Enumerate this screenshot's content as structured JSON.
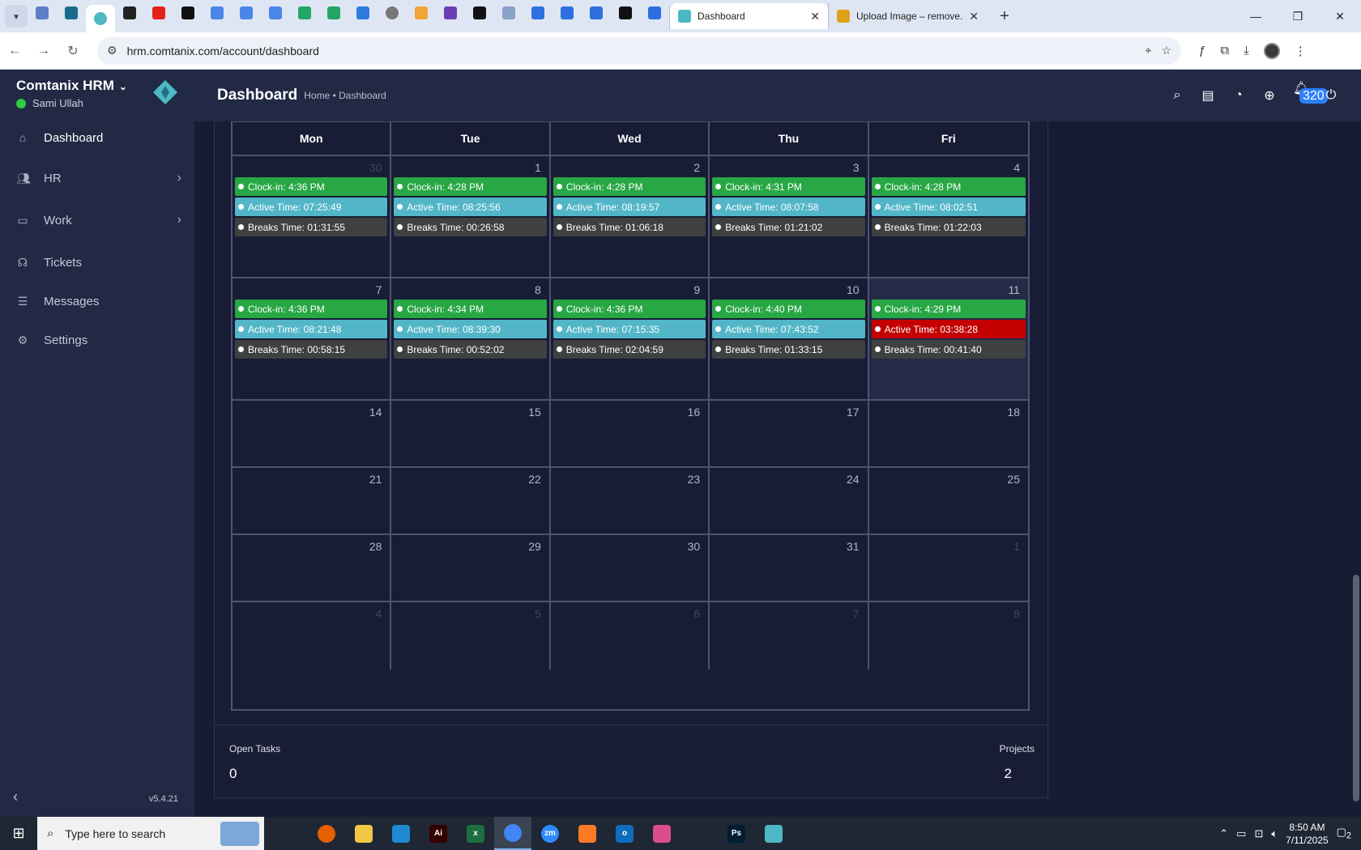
{
  "browser": {
    "tabs": [
      {
        "icon": "chart-favicon-icon",
        "color": "#5b7ec9"
      },
      {
        "icon": "shield-favicon-icon",
        "color": "#1a6b8a"
      },
      {
        "icon": "comtanix-favicon-icon",
        "color": "#4db8c4",
        "active": true
      },
      {
        "icon": "chatgpt-favicon-icon",
        "color": "#222222"
      },
      {
        "icon": "youtube-favicon-icon",
        "color": "#e62117"
      },
      {
        "icon": "bolt-favicon-icon",
        "color": "#111111"
      },
      {
        "icon": "docs-favicon-icon",
        "color": "#4a86e8"
      },
      {
        "icon": "docs-favicon-icon",
        "color": "#4a86e8"
      },
      {
        "icon": "docs-favicon-icon",
        "color": "#4a86e8"
      },
      {
        "icon": "sheets-favicon-icon",
        "color": "#23a566"
      },
      {
        "icon": "sheets-favicon-icon",
        "color": "#23a566"
      },
      {
        "icon": "app-favicon-icon",
        "color": "#2d7be0"
      },
      {
        "icon": "globe-favicon-icon",
        "color": "#777777"
      },
      {
        "icon": "heart-favicon-icon",
        "color": "#f2a33a"
      },
      {
        "icon": "code-favicon-icon",
        "color": "#6a3fb5"
      },
      {
        "icon": "a-favicon-icon",
        "color": "#111111"
      },
      {
        "icon": "grid-favicon-icon",
        "color": "#8aa1c8"
      },
      {
        "icon": "forms-favicon-icon",
        "color": "#2d6fe0"
      },
      {
        "icon": "forms-favicon-icon",
        "color": "#2d6fe0"
      },
      {
        "icon": "forms-favicon-icon",
        "color": "#2d6fe0"
      },
      {
        "icon": "m-favicon-icon",
        "color": "#111111"
      },
      {
        "icon": "forms-favicon-icon",
        "color": "#2d6fe0"
      }
    ],
    "tab_dashboard": "Dashboard",
    "tab_upload": "Upload Image – remove.",
    "url": "hrm.comtanix.com/account/dashboard"
  },
  "sidebar": {
    "brand": "Comtanix HRM",
    "user": "Sami Ullah",
    "items": [
      {
        "label": "Dashboard",
        "icon": "home-icon",
        "has_arrow": false,
        "active": true
      },
      {
        "label": "HR",
        "icon": "users-icon",
        "has_arrow": true
      },
      {
        "label": "Work",
        "icon": "briefcase-icon",
        "has_arrow": true
      },
      {
        "label": "Tickets",
        "icon": "headset-icon",
        "has_arrow": false
      },
      {
        "label": "Messages",
        "icon": "chat-icon",
        "has_arrow": false
      },
      {
        "label": "Settings",
        "icon": "gear-icon",
        "has_arrow": false
      }
    ],
    "version": "v5.4.21"
  },
  "header": {
    "title": "Dashboard",
    "breadcrumb": "Home • Dashboard",
    "notifications": "320"
  },
  "calendar": {
    "weekdays": [
      "Mon",
      "Tue",
      "Wed",
      "Thu",
      "Fri"
    ],
    "weeks": [
      [
        {
          "day": "30",
          "faded": true,
          "events": [
            [
              "green",
              "Clock-in: 4:36 PM"
            ],
            [
              "teal",
              "Active Time: 07:25:49"
            ],
            [
              "dark",
              "Breaks Time: 01:31:55"
            ]
          ]
        },
        {
          "day": "1",
          "events": [
            [
              "green",
              "Clock-in: 4:28 PM"
            ],
            [
              "teal",
              "Active Time: 08:25:56"
            ],
            [
              "dark",
              "Breaks Time: 00:26:58"
            ]
          ]
        },
        {
          "day": "2",
          "events": [
            [
              "green",
              "Clock-in: 4:28 PM"
            ],
            [
              "teal",
              "Active Time: 08:19:57"
            ],
            [
              "dark",
              "Breaks Time: 01:06:18"
            ]
          ]
        },
        {
          "day": "3",
          "events": [
            [
              "green",
              "Clock-in: 4:31 PM"
            ],
            [
              "teal",
              "Active Time: 08:07:58"
            ],
            [
              "dark",
              "Breaks Time: 01:21:02"
            ]
          ]
        },
        {
          "day": "4",
          "events": [
            [
              "green",
              "Clock-in: 4:28 PM"
            ],
            [
              "teal",
              "Active Time: 08:02:51"
            ],
            [
              "dark",
              "Breaks Time: 01:22:03"
            ]
          ]
        }
      ],
      [
        {
          "day": "7",
          "events": [
            [
              "green",
              "Clock-in: 4:36 PM"
            ],
            [
              "teal",
              "Active Time: 08:21:48"
            ],
            [
              "dark",
              "Breaks Time: 00:58:15"
            ]
          ]
        },
        {
          "day": "8",
          "events": [
            [
              "green",
              "Clock-in: 4:34 PM"
            ],
            [
              "teal",
              "Active Time: 08:39:30"
            ],
            [
              "dark",
              "Breaks Time: 00:52:02"
            ]
          ]
        },
        {
          "day": "9",
          "events": [
            [
              "green",
              "Clock-in: 4:36 PM"
            ],
            [
              "teal",
              "Active Time: 07:15:35"
            ],
            [
              "dark",
              "Breaks Time: 02:04:59"
            ]
          ]
        },
        {
          "day": "10",
          "events": [
            [
              "green",
              "Clock-in: 4:40 PM"
            ],
            [
              "teal",
              "Active Time: 07:43:52"
            ],
            [
              "dark",
              "Breaks Time: 01:33:15"
            ]
          ]
        },
        {
          "day": "11",
          "today": true,
          "events": [
            [
              "green",
              "Clock-in: 4:29 PM"
            ],
            [
              "red",
              "Active Time: 03:38:28"
            ],
            [
              "dark",
              "Breaks Time: 00:41:40"
            ]
          ]
        }
      ],
      [
        {
          "day": "14",
          "events": []
        },
        {
          "day": "15",
          "events": []
        },
        {
          "day": "16",
          "events": []
        },
        {
          "day": "17",
          "events": []
        },
        {
          "day": "18",
          "events": []
        }
      ],
      [
        {
          "day": "21",
          "events": []
        },
        {
          "day": "22",
          "events": []
        },
        {
          "day": "23",
          "events": []
        },
        {
          "day": "24",
          "events": []
        },
        {
          "day": "25",
          "events": []
        }
      ],
      [
        {
          "day": "28",
          "events": []
        },
        {
          "day": "29",
          "events": []
        },
        {
          "day": "30",
          "events": []
        },
        {
          "day": "31",
          "events": []
        },
        {
          "day": "1",
          "faded": true,
          "events": []
        }
      ],
      [
        {
          "day": "4",
          "faded": true,
          "events": []
        },
        {
          "day": "5",
          "faded": true,
          "events": []
        },
        {
          "day": "6",
          "faded": true,
          "events": []
        },
        {
          "day": "7",
          "faded": true,
          "events": []
        },
        {
          "day": "8",
          "faded": true,
          "events": []
        }
      ]
    ]
  },
  "stats": {
    "open_tasks_label": "Open Tasks",
    "open_tasks_value": "0",
    "projects_label": "Projects",
    "projects_value": "2"
  },
  "taskbar": {
    "search_placeholder": "Type here to search",
    "apps": [
      {
        "icon": "task-view-icon",
        "color": "#1f2734",
        "text": ""
      },
      {
        "icon": "firefox-icon",
        "color": "#e66000",
        "text": ""
      },
      {
        "icon": "folder-icon",
        "color": "#f2c744",
        "text": ""
      },
      {
        "icon": "vscode-icon",
        "color": "#1f8ad2",
        "text": ""
      },
      {
        "icon": "illustrator-icon",
        "color": "#330000",
        "text": "Ai"
      },
      {
        "icon": "excel-icon",
        "color": "#1d6f42",
        "text": "x"
      },
      {
        "icon": "chrome-icon",
        "color": "#4285f4",
        "text": "",
        "active": true
      },
      {
        "icon": "zoom-icon",
        "color": "#2d8cff",
        "text": "zm"
      },
      {
        "icon": "xampp-icon",
        "color": "#fb7a24",
        "text": ""
      },
      {
        "icon": "outlook-icon",
        "color": "#0f6cbd",
        "text": "o"
      },
      {
        "icon": "photos-icon",
        "color": "#d94d8f",
        "text": ""
      },
      {
        "icon": "pen-icon",
        "color": "#1f2734",
        "text": ""
      },
      {
        "icon": "photoshop-icon",
        "color": "#001d34",
        "text": "Ps"
      },
      {
        "icon": "comtanix-app-icon",
        "color": "#4db8c4",
        "text": ""
      }
    ],
    "time": "8:50 AM",
    "date": "7/11/2025",
    "notif_count": "2"
  }
}
